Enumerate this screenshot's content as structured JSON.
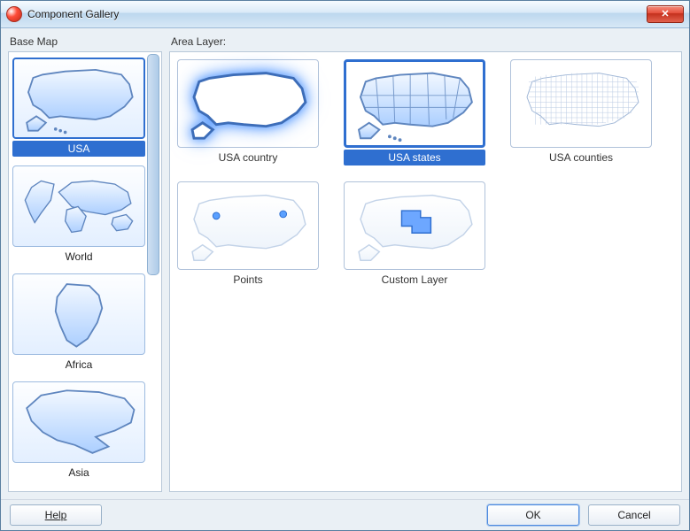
{
  "window": {
    "title": "Component Gallery"
  },
  "sidebar": {
    "label": "Base Map",
    "items": [
      {
        "label": "USA",
        "icon": "usa-map-icon",
        "selected": true
      },
      {
        "label": "World",
        "icon": "world-map-icon",
        "selected": false
      },
      {
        "label": "Africa",
        "icon": "africa-map-icon",
        "selected": false
      },
      {
        "label": "Asia",
        "icon": "asia-map-icon",
        "selected": false
      }
    ]
  },
  "area": {
    "label": "Area Layer:",
    "items": [
      {
        "label": "USA country",
        "icon": "usa-country-icon",
        "selected": false
      },
      {
        "label": "USA states",
        "icon": "usa-states-icon",
        "selected": true
      },
      {
        "label": "USA counties",
        "icon": "usa-counties-icon",
        "selected": false
      },
      {
        "label": "Points",
        "icon": "usa-points-icon",
        "selected": false
      },
      {
        "label": "Custom Layer",
        "icon": "usa-custom-icon",
        "selected": false
      }
    ]
  },
  "buttons": {
    "help": "Help",
    "ok": "OK",
    "cancel": "Cancel"
  },
  "colors": {
    "accent": "#2f6fd0",
    "map_fill_a": "#e8f2ff",
    "map_fill_b": "#b8d6ff",
    "map_stroke": "#5f86bf"
  }
}
